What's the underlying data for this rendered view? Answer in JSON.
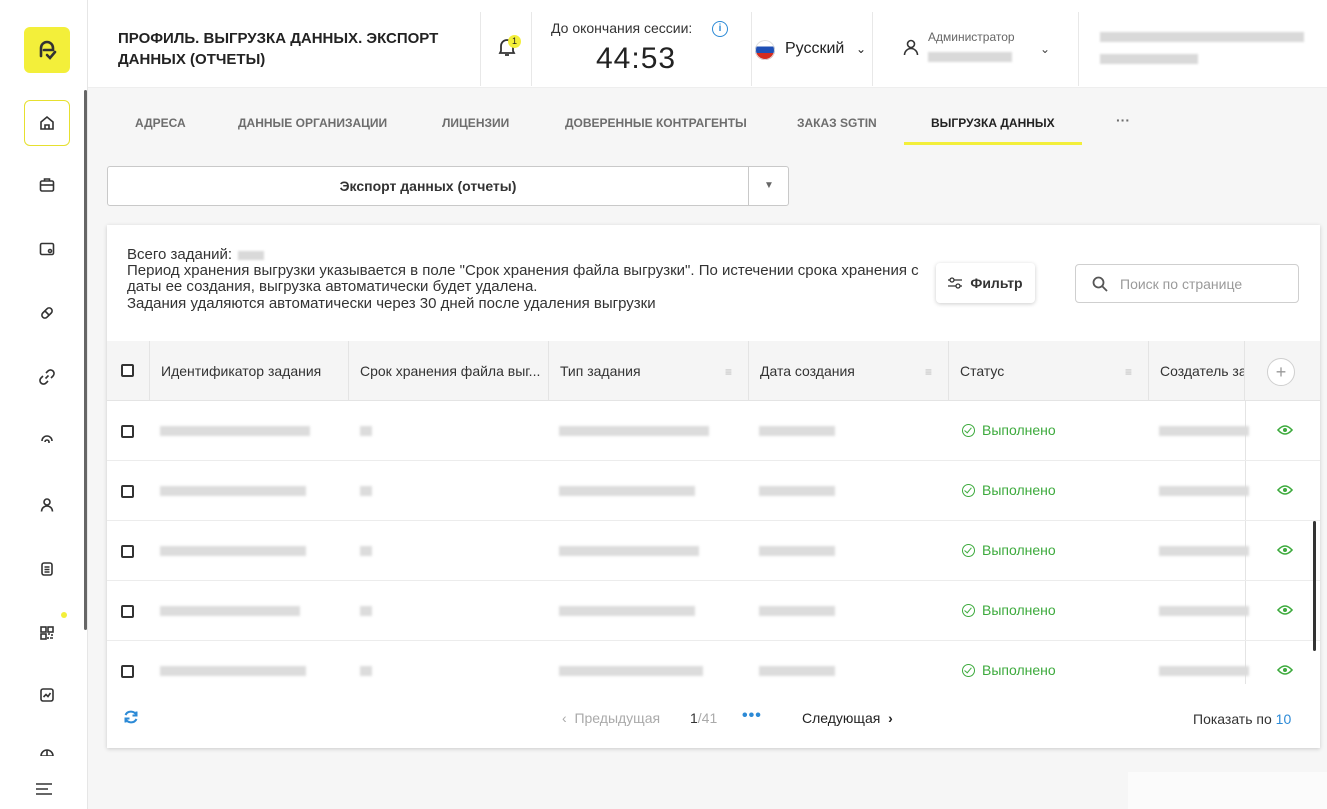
{
  "header": {
    "title": "ПРОФИЛЬ. ВЫГРУЗКА ДАННЫХ. ЭКСПОРТ ДАННЫХ (ОТЧЕТЫ)",
    "notification_count": "1",
    "session_label": "До окончания сессии:",
    "session_info_icon": "i",
    "session_time": "44:53",
    "language": "Русский",
    "user_role": "Администратор"
  },
  "tabs": [
    {
      "label": "АДРЕСА"
    },
    {
      "label": "ДАННЫЕ ОРГАНИЗАЦИИ"
    },
    {
      "label": "ЛИЦЕНЗИИ"
    },
    {
      "label": "ДОВЕРЕННЫЕ КОНТРАГЕНТЫ"
    },
    {
      "label": "ЗАКАЗ SGTIN"
    },
    {
      "label": "ВЫГРУЗКА ДАННЫХ"
    },
    {
      "label": "···"
    }
  ],
  "dropdown": {
    "selected": "Экспорт данных (отчеты)",
    "arrow": "▼"
  },
  "info": {
    "total_label": "Всего заданий:",
    "line1": "Период хранения выгрузки указывается в поле \"Срок хранения файла выгрузки\". По истечении срока хранения с даты ее создания, выгрузка автоматически будет удалена.",
    "line2": "Задания удаляются автоматически через 30 дней после удаления выгрузки"
  },
  "filter_label": "Фильтр",
  "search": {
    "placeholder": "Поиск по странице"
  },
  "table": {
    "columns": [
      "Идентификатор задания",
      "Срок хранения файла выг...",
      "Тип задания",
      "Дата создания",
      "Статус",
      "Создатель за"
    ],
    "add_column": "+",
    "rows": [
      {
        "status": "Выполнено"
      },
      {
        "status": "Выполнено"
      },
      {
        "status": "Выполнено"
      },
      {
        "status": "Выполнено"
      },
      {
        "status": "Выполнено"
      }
    ]
  },
  "pagination": {
    "prev": "Предыдущая",
    "current": "1",
    "total": "/41",
    "dots": "•••",
    "next": "Следующая",
    "page_size_label": "Показать по",
    "page_size": "10"
  },
  "colors": {
    "accent": "#f3ef3a",
    "link": "#2c8ad6",
    "success": "#3daa3d"
  }
}
